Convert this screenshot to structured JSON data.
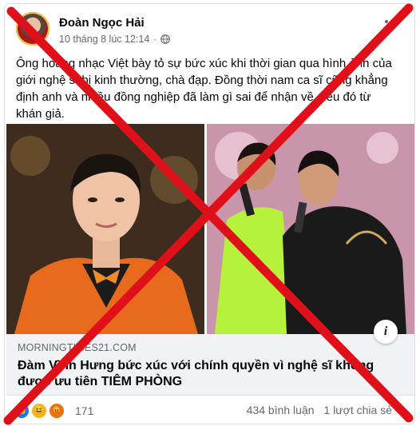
{
  "post": {
    "author": "Đoàn Ngọc Hải",
    "timestamp": "10 tháng 8 lúc 12:14",
    "separator": "·",
    "privacy_icon": "globe-icon",
    "more_icon": "more-options-icon",
    "text": "Ông hoàng nhạc Việt bày tỏ sự bức xúc khi thời gian qua hình ảnh của giới nghệ sĩ bị kinh thường, chà đạp. Đồng thời nam ca sĩ cũng khẳng định anh và nhiều đồng nghiệp đã làm gì sai để nhận về điều đó từ khán giả."
  },
  "link_preview": {
    "domain": "MORNINGTIMES21.COM",
    "title": "Đàm Vĩnh Hưng bức xúc với chính quyền vì nghệ sĩ không được ưu tiên TIÊM PHÒNG",
    "info_icon": "info-icon"
  },
  "footer": {
    "reactions": [
      "like-icon",
      "haha-icon",
      "angry-icon"
    ],
    "reaction_count": "171",
    "comments": "434 bình luận",
    "shares": "1 lượt chia sẻ"
  },
  "overlay": {
    "color": "#e0101a",
    "icon": "red-cross-mark"
  }
}
